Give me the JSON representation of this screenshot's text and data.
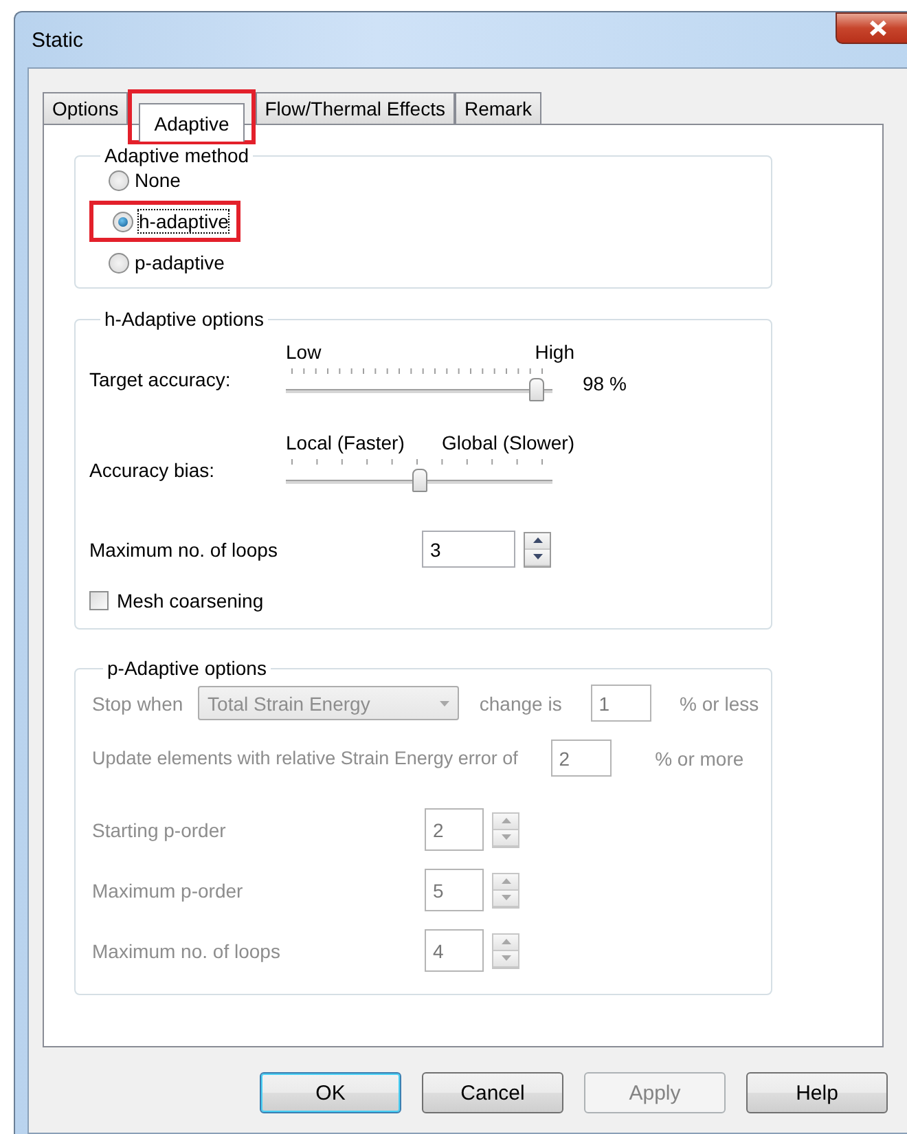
{
  "window": {
    "title": "Static"
  },
  "tabs": [
    {
      "label": "Options",
      "selected": false,
      "highlighted": false
    },
    {
      "label": "Adaptive",
      "selected": true,
      "highlighted": true
    },
    {
      "label": "Flow/Thermal Effects",
      "selected": false,
      "highlighted": false
    },
    {
      "label": "Remark",
      "selected": false,
      "highlighted": false
    }
  ],
  "adaptive_method": {
    "title": "Adaptive method",
    "options": [
      {
        "label": "None",
        "selected": false,
        "highlighted": false
      },
      {
        "label": "h-adaptive",
        "selected": true,
        "highlighted": true
      },
      {
        "label": "p-adaptive",
        "selected": false,
        "highlighted": false
      }
    ]
  },
  "h_adaptive": {
    "title": "h-Adaptive options",
    "sliders": [
      {
        "label": "Target accuracy:",
        "low": "Low",
        "high": "High",
        "level": 0.94,
        "reading": "98 %"
      },
      {
        "label": "Accuracy bias:",
        "low": "Local (Faster)",
        "high": "Global (Slower)",
        "level": 0.5
      }
    ],
    "max_loops": {
      "label": "Maximum no. of loops",
      "value": "3"
    },
    "mesh_coarsening": {
      "label": "Mesh coarsening",
      "checked": false
    }
  },
  "p_adaptive": {
    "title": "p-Adaptive options",
    "disabled": true,
    "stop_when": {
      "label": "Stop when",
      "combo": "Total Strain Energy",
      "middle": "change is",
      "value": "1",
      "suffix": "% or less"
    },
    "update": {
      "label": "Update elements with relative Strain Energy error of",
      "value": "2",
      "suffix": "% or more"
    },
    "spinners": [
      {
        "label": "Starting p-order",
        "value": "2"
      },
      {
        "label": "Maximum p-order",
        "value": "5"
      },
      {
        "label": "Maximum no. of loops",
        "value": "4"
      }
    ]
  },
  "buttons": [
    {
      "label": "OK",
      "default": true,
      "disabled": false
    },
    {
      "label": "Cancel",
      "default": false,
      "disabled": false
    },
    {
      "label": "Apply",
      "default": false,
      "disabled": true
    },
    {
      "label": "Help",
      "default": false,
      "disabled": false
    }
  ]
}
